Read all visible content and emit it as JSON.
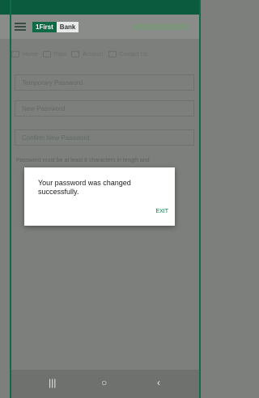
{
  "app": {
    "logo_first": "1First",
    "logo_bank": "Bank"
  },
  "tabs": [
    {
      "label": "Home",
      "icon": "home-icon"
    },
    {
      "label": "Pass",
      "icon": "key-icon"
    },
    {
      "label": "Account",
      "icon": "user-icon"
    },
    {
      "label": "Contact Us",
      "icon": "phone-icon"
    }
  ],
  "form": {
    "temporary_password": {
      "placeholder": "Temporary Password"
    },
    "new_password": {
      "placeholder": "New Password"
    },
    "confirm_password": {
      "placeholder": "Confirm New Password"
    },
    "instruction": "Password must be at least 8 characters in length and"
  },
  "dialog": {
    "message": "Your password was changed successfully.",
    "exit_label": "EXIT"
  },
  "navbar": {
    "recent_symbol": "|||",
    "home_symbol": "○",
    "back_symbol": "‹"
  },
  "colors": {
    "brand_green": "#0d6a45",
    "dialog_action": "#0f7a4e",
    "overlay": "#7d7f7d"
  }
}
